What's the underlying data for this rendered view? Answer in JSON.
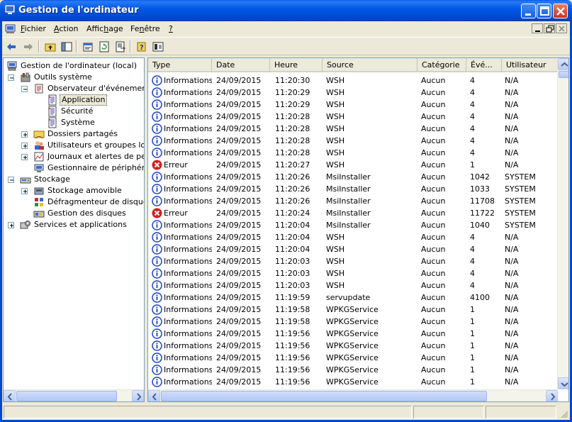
{
  "window": {
    "title": "Gestion de l'ordinateur",
    "app_icon": "computer-management-icon",
    "accent": "#0054e3"
  },
  "menu": {
    "items": [
      {
        "label": "Fichier",
        "underline": "F"
      },
      {
        "label": "Action",
        "underline": "A"
      },
      {
        "label": "Affichage",
        "underline": "h"
      },
      {
        "label": "Fenêtre",
        "underline": "n"
      },
      {
        "label": "?",
        "underline": "?"
      }
    ]
  },
  "toolbar": {
    "buttons": [
      "back-arrow-icon",
      "forward-arrow-icon",
      "up-folder-icon",
      "show-hide-tree-icon",
      "properties-icon",
      "refresh-icon",
      "export-list-icon",
      "help-icon",
      "console-tree-icon"
    ]
  },
  "tree": {
    "items": [
      {
        "label": "Gestion de l'ordinateur (local)",
        "level": 0,
        "icon": "computer-icon",
        "expander": "none"
      },
      {
        "label": "Outils système",
        "level": 1,
        "icon": "tools-icon",
        "expander": "minus"
      },
      {
        "label": "Observateur d'événements",
        "level": 2,
        "icon": "event-viewer-icon",
        "expander": "minus"
      },
      {
        "label": "Application",
        "level": 3,
        "icon": "log-icon",
        "expander": "none",
        "selected": true
      },
      {
        "label": "Sécurité",
        "level": 3,
        "icon": "log-icon",
        "expander": "none"
      },
      {
        "label": "Système",
        "level": 3,
        "icon": "log-icon",
        "expander": "none"
      },
      {
        "label": "Dossiers partagés",
        "level": 2,
        "icon": "shared-folder-icon",
        "expander": "plus"
      },
      {
        "label": "Utilisateurs et groupes locau",
        "level": 2,
        "icon": "users-icon",
        "expander": "plus"
      },
      {
        "label": "Journaux et alertes de perfo",
        "level": 2,
        "icon": "performance-logs-icon",
        "expander": "plus"
      },
      {
        "label": "Gestionnaire de périphérique",
        "level": 2,
        "icon": "device-manager-icon",
        "expander": "none"
      },
      {
        "label": "Stockage",
        "level": 1,
        "icon": "storage-icon",
        "expander": "minus"
      },
      {
        "label": "Stockage amovible",
        "level": 2,
        "icon": "removable-storage-icon",
        "expander": "plus"
      },
      {
        "label": "Défragmenteur de disque",
        "level": 2,
        "icon": "defrag-icon",
        "expander": "none"
      },
      {
        "label": "Gestion des disques",
        "level": 2,
        "icon": "disk-management-icon",
        "expander": "none"
      },
      {
        "label": "Services et applications",
        "level": 1,
        "icon": "services-icon",
        "expander": "plus"
      }
    ]
  },
  "list": {
    "columns": [
      "Type",
      "Date",
      "Heure",
      "Source",
      "Catégorie",
      "Évé...",
      "Utilisateur"
    ],
    "rows": [
      {
        "type": "Informations",
        "kind": "info",
        "date": "24/09/2015",
        "time": "11:20:30",
        "source": "WSH",
        "category": "Aucun",
        "event": "4",
        "user": "N/A"
      },
      {
        "type": "Informations",
        "kind": "info",
        "date": "24/09/2015",
        "time": "11:20:29",
        "source": "WSH",
        "category": "Aucun",
        "event": "4",
        "user": "N/A"
      },
      {
        "type": "Informations",
        "kind": "info",
        "date": "24/09/2015",
        "time": "11:20:29",
        "source": "WSH",
        "category": "Aucun",
        "event": "4",
        "user": "N/A"
      },
      {
        "type": "Informations",
        "kind": "info",
        "date": "24/09/2015",
        "time": "11:20:28",
        "source": "WSH",
        "category": "Aucun",
        "event": "4",
        "user": "N/A"
      },
      {
        "type": "Informations",
        "kind": "info",
        "date": "24/09/2015",
        "time": "11:20:28",
        "source": "WSH",
        "category": "Aucun",
        "event": "4",
        "user": "N/A"
      },
      {
        "type": "Informations",
        "kind": "info",
        "date": "24/09/2015",
        "time": "11:20:28",
        "source": "WSH",
        "category": "Aucun",
        "event": "4",
        "user": "N/A"
      },
      {
        "type": "Informations",
        "kind": "info",
        "date": "24/09/2015",
        "time": "11:20:28",
        "source": "WSH",
        "category": "Aucun",
        "event": "4",
        "user": "N/A"
      },
      {
        "type": "Erreur",
        "kind": "error",
        "date": "24/09/2015",
        "time": "11:20:27",
        "source": "WSH",
        "category": "Aucun",
        "event": "1",
        "user": "N/A"
      },
      {
        "type": "Informations",
        "kind": "info",
        "date": "24/09/2015",
        "time": "11:20:26",
        "source": "MsiInstaller",
        "category": "Aucun",
        "event": "1042",
        "user": "SYSTEM"
      },
      {
        "type": "Informations",
        "kind": "info",
        "date": "24/09/2015",
        "time": "11:20:26",
        "source": "MsiInstaller",
        "category": "Aucun",
        "event": "1033",
        "user": "SYSTEM"
      },
      {
        "type": "Informations",
        "kind": "info",
        "date": "24/09/2015",
        "time": "11:20:26",
        "source": "MsiInstaller",
        "category": "Aucun",
        "event": "11708",
        "user": "SYSTEM"
      },
      {
        "type": "Erreur",
        "kind": "error",
        "date": "24/09/2015",
        "time": "11:20:24",
        "source": "MsiInstaller",
        "category": "Aucun",
        "event": "11722",
        "user": "SYSTEM"
      },
      {
        "type": "Informations",
        "kind": "info",
        "date": "24/09/2015",
        "time": "11:20:04",
        "source": "MsiInstaller",
        "category": "Aucun",
        "event": "1040",
        "user": "SYSTEM"
      },
      {
        "type": "Informations",
        "kind": "info",
        "date": "24/09/2015",
        "time": "11:20:04",
        "source": "WSH",
        "category": "Aucun",
        "event": "4",
        "user": "N/A"
      },
      {
        "type": "Informations",
        "kind": "info",
        "date": "24/09/2015",
        "time": "11:20:04",
        "source": "WSH",
        "category": "Aucun",
        "event": "4",
        "user": "N/A"
      },
      {
        "type": "Informations",
        "kind": "info",
        "date": "24/09/2015",
        "time": "11:20:03",
        "source": "WSH",
        "category": "Aucun",
        "event": "4",
        "user": "N/A"
      },
      {
        "type": "Informations",
        "kind": "info",
        "date": "24/09/2015",
        "time": "11:20:03",
        "source": "WSH",
        "category": "Aucun",
        "event": "4",
        "user": "N/A"
      },
      {
        "type": "Informations",
        "kind": "info",
        "date": "24/09/2015",
        "time": "11:20:03",
        "source": "WSH",
        "category": "Aucun",
        "event": "4",
        "user": "N/A"
      },
      {
        "type": "Informations",
        "kind": "info",
        "date": "24/09/2015",
        "time": "11:19:59",
        "source": "servupdate",
        "category": "Aucun",
        "event": "4100",
        "user": "N/A"
      },
      {
        "type": "Informations",
        "kind": "info",
        "date": "24/09/2015",
        "time": "11:19:58",
        "source": "WPKGService",
        "category": "Aucun",
        "event": "1",
        "user": "N/A"
      },
      {
        "type": "Informations",
        "kind": "info",
        "date": "24/09/2015",
        "time": "11:19:58",
        "source": "WPKGService",
        "category": "Aucun",
        "event": "1",
        "user": "N/A"
      },
      {
        "type": "Informations",
        "kind": "info",
        "date": "24/09/2015",
        "time": "11:19:56",
        "source": "WPKGService",
        "category": "Aucun",
        "event": "1",
        "user": "N/A"
      },
      {
        "type": "Informations",
        "kind": "info",
        "date": "24/09/2015",
        "time": "11:19:56",
        "source": "WPKGService",
        "category": "Aucun",
        "event": "1",
        "user": "N/A"
      },
      {
        "type": "Informations",
        "kind": "info",
        "date": "24/09/2015",
        "time": "11:19:56",
        "source": "WPKGService",
        "category": "Aucun",
        "event": "1",
        "user": "N/A"
      },
      {
        "type": "Informations",
        "kind": "info",
        "date": "24/09/2015",
        "time": "11:19:56",
        "source": "WPKGService",
        "category": "Aucun",
        "event": "1",
        "user": "N/A"
      },
      {
        "type": "Informations",
        "kind": "info",
        "date": "24/09/2015",
        "time": "11:19:56",
        "source": "WPKGService",
        "category": "Aucun",
        "event": "1",
        "user": "N/A"
      }
    ]
  },
  "colors": {
    "info_icon": "#1f3fbf",
    "error_icon": "#d81e1e",
    "selection": "#ece9d8"
  }
}
